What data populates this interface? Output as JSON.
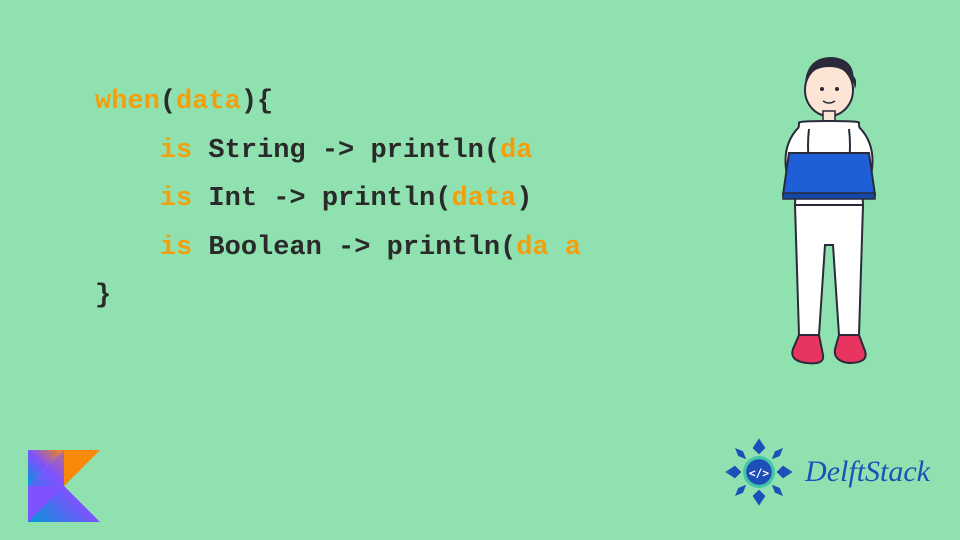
{
  "code": {
    "line1_tok1": "when",
    "line1_tok2": "(",
    "line1_tok3": "data",
    "line1_tok4": "){",
    "line2_tok1": "    is",
    "line2_tok2": " String -> println(",
    "line2_tok3": "da",
    "line3_tok1": "    is",
    "line3_tok2": " Int -> println(",
    "line3_tok3": "data",
    "line3_tok4": ")",
    "line4_tok1": "    is",
    "line4_tok2": " Boolean -> println(",
    "line4_tok3": "da a",
    "line5_tok1": "}"
  },
  "logo": {
    "brand": "DelftStack"
  },
  "colors": {
    "bg": "#8fe2b0",
    "keyword": "#f59e0b",
    "text": "#2a2a2a",
    "delft_blue": "#1e4fb8",
    "kotlin_purple": "#7f52ff",
    "kotlin_orange": "#f88909"
  }
}
